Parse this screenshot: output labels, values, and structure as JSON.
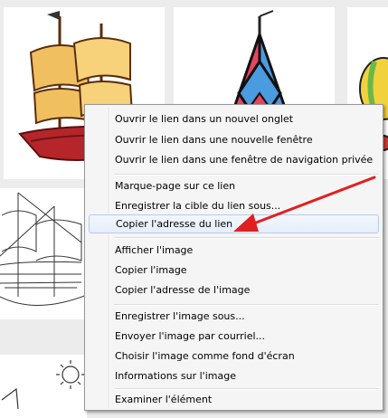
{
  "context_menu": {
    "items": [
      {
        "label": "Ouvrir le lien dans un nouvel onglet"
      },
      {
        "label": "Ouvrir le lien dans une nouvelle fenêtre"
      },
      {
        "label": "Ouvrir le lien dans une fenêtre de navigation privée"
      },
      {
        "label": "Marque-page sur ce lien"
      },
      {
        "label": "Enregistrer la cible du lien sous..."
      },
      {
        "label": "Copier l'adresse du lien",
        "highlighted": true
      },
      {
        "label": "Afficher l'image"
      },
      {
        "label": "Copier l'image"
      },
      {
        "label": "Copier l'adresse de l'image"
      },
      {
        "label": "Enregistrer l'image sous..."
      },
      {
        "label": "Envoyer l'image par courriel..."
      },
      {
        "label": "Choisir l'image comme fond d'écran"
      },
      {
        "label": "Informations sur l'image"
      },
      {
        "label": "Examiner l'élément"
      }
    ]
  },
  "annotation": {
    "arrow_color": "#e02020"
  },
  "background_images": [
    {
      "icon": "pirate-ship-color-image"
    },
    {
      "icon": "sailboat-color-image"
    },
    {
      "icon": "hot-air-balloon-image"
    },
    {
      "icon": "ship-line-drawing-image"
    },
    {
      "icon": "sun-sketch-image"
    }
  ]
}
